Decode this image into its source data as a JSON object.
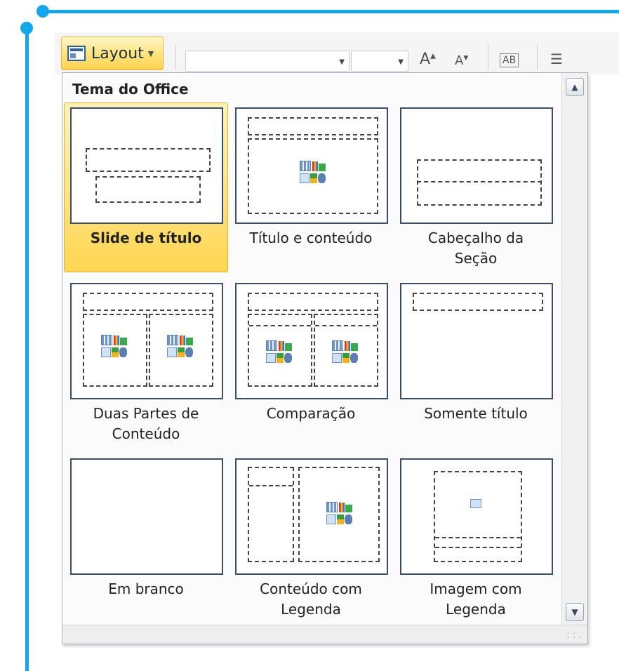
{
  "ribbon": {
    "layout_button_label": "Layout",
    "icons": [
      "layout-icon",
      "font-grow-icon",
      "font-shrink-icon",
      "clear-formatting-icon",
      "bullets-icon"
    ]
  },
  "gallery": {
    "header": "Tema do Office",
    "layouts": [
      {
        "id": "slide-de-titulo",
        "label": "Slide de título",
        "selected": true
      },
      {
        "id": "titulo-e-conteudo",
        "label": "Título e conteúdo",
        "selected": false
      },
      {
        "id": "cabecalho-da-secao",
        "label": "Cabeçalho da\nSeção",
        "selected": false
      },
      {
        "id": "duas-partes",
        "label": "Duas Partes de\nConteúdo",
        "selected": false
      },
      {
        "id": "comparacao",
        "label": "Comparação",
        "selected": false
      },
      {
        "id": "somente-titulo",
        "label": "Somente título",
        "selected": false
      },
      {
        "id": "em-branco",
        "label": "Em branco",
        "selected": false
      },
      {
        "id": "conteudo-com-legenda",
        "label": "Conteúdo com\nLegenda",
        "selected": false
      },
      {
        "id": "imagem-com-legenda",
        "label": "Imagem com\nLegenda",
        "selected": false
      }
    ]
  },
  "colors": {
    "accent": "#14a6e8",
    "selection": "#ffd653",
    "thumb_border": "#3a4e66"
  }
}
